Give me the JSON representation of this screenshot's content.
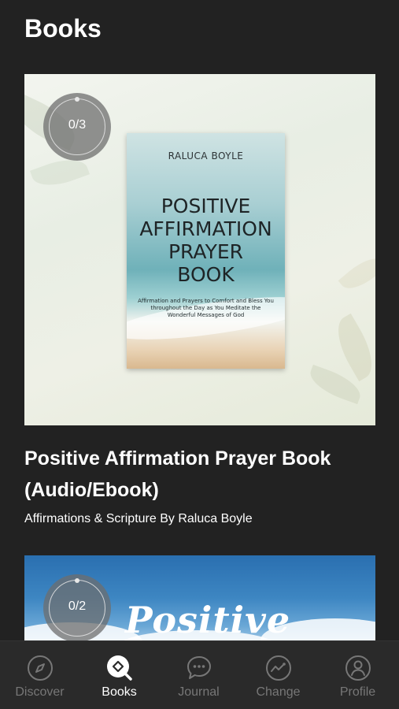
{
  "header": {
    "title": "Books"
  },
  "books": [
    {
      "progress": "0/3",
      "cover": {
        "author": "RALUCA BOYLE",
        "title_lines": [
          "POSITIVE",
          "AFFIRMATION",
          "PRAYER",
          "BOOK"
        ],
        "subtitle": "Affirmation and Prayers to Comfort and Bless You throughout the Day as You Meditate the Wonderful Messages of God"
      },
      "title": "Positive Affirmation Prayer Book (Audio/Ebook)",
      "meta": "Affirmations & Scripture By Raluca Boyle"
    },
    {
      "progress": "0/2",
      "cover": {
        "headline": "Positive"
      }
    }
  ],
  "tabbar": {
    "items": [
      {
        "label": "Discover",
        "icon": "compass-icon",
        "active": false
      },
      {
        "label": "Books",
        "icon": "book-search-icon",
        "active": true
      },
      {
        "label": "Journal",
        "icon": "chat-bubble-icon",
        "active": false
      },
      {
        "label": "Change",
        "icon": "trend-icon",
        "active": false
      },
      {
        "label": "Profile",
        "icon": "person-icon",
        "active": false
      }
    ]
  },
  "colors": {
    "background": "#222222",
    "tabbar": "#2a2a2a",
    "tab_inactive": "#777777",
    "tab_active": "#ffffff"
  }
}
